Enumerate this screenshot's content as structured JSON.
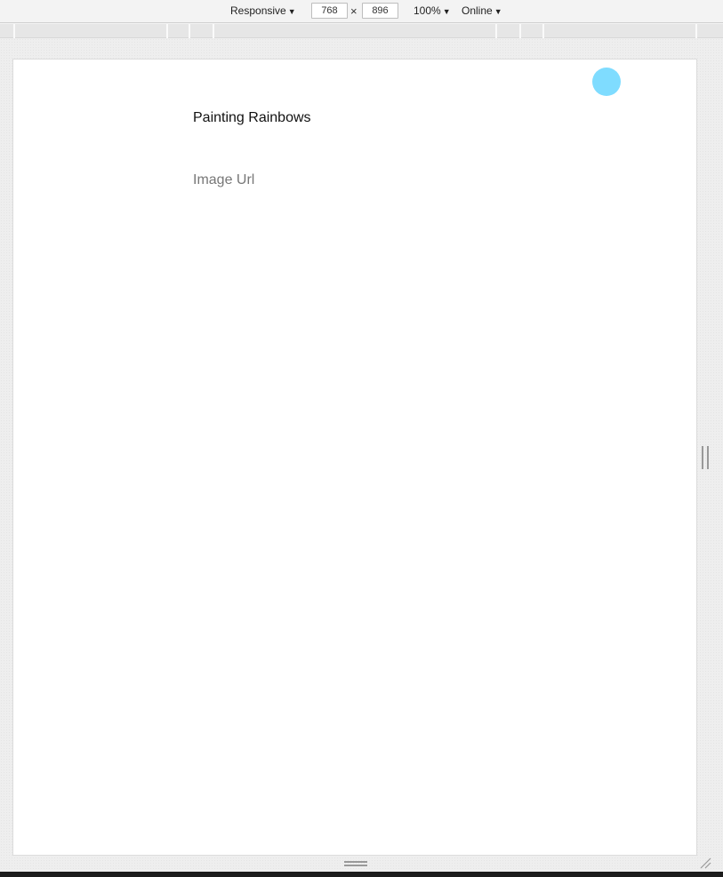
{
  "toolbar": {
    "device_label": "Responsive",
    "width_value": "768",
    "height_value": "896",
    "times_symbol": "×",
    "zoom_label": "100%",
    "network_label": "Online",
    "arrow": "▼"
  },
  "page": {
    "title": "Painting Rainbows",
    "image_url_label": "Image Url"
  },
  "colors": {
    "touch_indicator": "#7fdcff"
  },
  "icons": {
    "dropdown": "triangle-down-icon",
    "resize_side": "resize-handle-icon",
    "resize_bottom": "resize-handle-icon",
    "resize_corner": "resize-corner-icon"
  }
}
